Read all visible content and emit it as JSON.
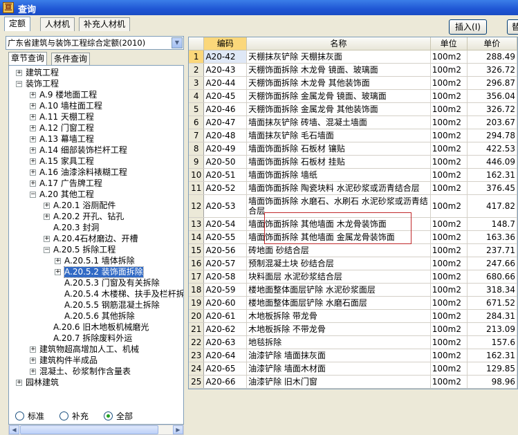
{
  "window": {
    "title": "查询",
    "app_icon": "app-icon"
  },
  "tabs": [
    {
      "label": "定额",
      "active": true
    },
    {
      "label": "人材机"
    },
    {
      "label": "补充人材机"
    }
  ],
  "toolbar": {
    "insert": "插入(I)",
    "more": "替"
  },
  "left": {
    "combo": "广东省建筑与装饰工程综合定额(2010)",
    "subtabs": [
      "章节查询",
      "条件查询"
    ],
    "tree": [
      {
        "lvl": 0,
        "exp": "+",
        "label": "建筑工程"
      },
      {
        "lvl": 0,
        "exp": "−",
        "label": "装饰工程"
      },
      {
        "lvl": 1,
        "exp": "+",
        "label": "A.9 楼地面工程"
      },
      {
        "lvl": 1,
        "exp": "+",
        "label": "A.10 墙柱面工程"
      },
      {
        "lvl": 1,
        "exp": "+",
        "label": "A.11 天棚工程"
      },
      {
        "lvl": 1,
        "exp": "+",
        "label": "A.12 门窗工程"
      },
      {
        "lvl": 1,
        "exp": "+",
        "label": "A.13 幕墙工程"
      },
      {
        "lvl": 1,
        "exp": "+",
        "label": "A.14 细部装饰栏杆工程"
      },
      {
        "lvl": 1,
        "exp": "+",
        "label": "A.15 家具工程"
      },
      {
        "lvl": 1,
        "exp": "+",
        "label": "A.16 油漆涂料裱糊工程"
      },
      {
        "lvl": 1,
        "exp": "+",
        "label": "A.17 广告牌工程"
      },
      {
        "lvl": 1,
        "exp": "−",
        "label": "A.20 其他工程"
      },
      {
        "lvl": 2,
        "exp": "+",
        "label": "A.20.1 浴厕配件"
      },
      {
        "lvl": 2,
        "exp": "+",
        "label": "A.20.2 开孔、钻孔"
      },
      {
        "lvl": 2,
        "exp": "",
        "label": "A.20.3 封洞"
      },
      {
        "lvl": 2,
        "exp": "+",
        "label": "A.20.4石材磨边、开槽"
      },
      {
        "lvl": 2,
        "exp": "−",
        "label": "A.20.5 拆除工程"
      },
      {
        "lvl": 3,
        "exp": "+",
        "label": "A.20.5.1 墙体拆除"
      },
      {
        "lvl": 3,
        "exp": "+",
        "label": "A.20.5.2 装饰面拆除",
        "sel": true
      },
      {
        "lvl": 3,
        "exp": "",
        "label": "A.20.5.3 门窗及有关拆除"
      },
      {
        "lvl": 3,
        "exp": "",
        "label": "A.20.5.4 木楼梯、扶手及栏杆拆"
      },
      {
        "lvl": 3,
        "exp": "",
        "label": "A.20.5.5 钢筋混凝土拆除"
      },
      {
        "lvl": 3,
        "exp": "",
        "label": "A.20.5.6 其他拆除"
      },
      {
        "lvl": 2,
        "exp": "",
        "label": "A.20.6 旧木地板机械磨光"
      },
      {
        "lvl": 2,
        "exp": "",
        "label": "A.20.7 拆除废料外运"
      },
      {
        "lvl": 1,
        "exp": "+",
        "label": "建筑物超高增加人工、机械"
      },
      {
        "lvl": 1,
        "exp": "+",
        "label": "建筑构件半成品"
      },
      {
        "lvl": 1,
        "exp": "+",
        "label": "混凝土、砂浆制作含量表"
      },
      {
        "lvl": 0,
        "exp": "+",
        "label": "园林建筑"
      }
    ],
    "radios": [
      {
        "label": "标准",
        "on": false
      },
      {
        "label": "补充",
        "on": false
      },
      {
        "label": "全部",
        "on": true
      }
    ]
  },
  "grid": {
    "headers": [
      "",
      "编码",
      "名称",
      "单位",
      "单价"
    ],
    "rows": [
      [
        "1",
        "A20-42",
        "天棚抹灰铲除 天棚抹灰面",
        "100m2",
        "288.49"
      ],
      [
        "2",
        "A20-43",
        "天棚饰面拆除 木龙骨 镜面、玻璃面",
        "100m2",
        "326.72"
      ],
      [
        "3",
        "A20-44",
        "天棚饰面拆除 木龙骨 其他装饰面",
        "100m2",
        "296.87"
      ],
      [
        "4",
        "A20-45",
        "天棚饰面拆除 金属龙骨 镜面、玻璃面",
        "100m2",
        "356.04"
      ],
      [
        "5",
        "A20-46",
        "天棚饰面拆除 金属龙骨 其他装饰面",
        "100m2",
        "326.72"
      ],
      [
        "6",
        "A20-47",
        "墙面抹灰铲除 砖墙、混凝土墙面",
        "100m2",
        "203.67"
      ],
      [
        "7",
        "A20-48",
        "墙面抹灰铲除 毛石墙面",
        "100m2",
        "294.78"
      ],
      [
        "8",
        "A20-49",
        "墙面饰面拆除 石板材 镶贴",
        "100m2",
        "422.53"
      ],
      [
        "9",
        "A20-50",
        "墙面饰面拆除 石板材 挂贴",
        "100m2",
        "446.09"
      ],
      [
        "10",
        "A20-51",
        "墙面饰面拆除 墙纸",
        "100m2",
        "162.31"
      ],
      [
        "11",
        "A20-52",
        "墙面饰面拆除 陶瓷块料 水泥砂浆或沥青结合层",
        "100m2",
        "376.45"
      ],
      [
        "12",
        "A20-53",
        "墙面饰面拆除 水磨石、水刷石 水泥砂浆或沥青结合层",
        "100m2",
        "417.82"
      ],
      [
        "13",
        "A20-54",
        "墙面饰面拆除 其他墙面 木龙骨装饰面",
        "100m2",
        "148.7"
      ],
      [
        "14",
        "A20-55",
        "墙面饰面拆除 其他墙面 金属龙骨装饰面",
        "100m2",
        "163.36"
      ],
      [
        "15",
        "A20-56",
        "砖地面 砂结合层",
        "100m2",
        "237.71"
      ],
      [
        "16",
        "A20-57",
        "预制混凝土块 砂结合层",
        "100m2",
        "247.66"
      ],
      [
        "17",
        "A20-58",
        "块料面层 水泥砂浆结合层",
        "100m2",
        "680.66"
      ],
      [
        "18",
        "A20-59",
        "楼地面整体面层铲除 水泥砂浆面层",
        "100m2",
        "318.34"
      ],
      [
        "19",
        "A20-60",
        "楼地面整体面层铲除 水磨石面层",
        "100m2",
        "671.52"
      ],
      [
        "20",
        "A20-61",
        "木地板拆除 带龙骨",
        "100m2",
        "284.31"
      ],
      [
        "21",
        "A20-62",
        "木地板拆除 不带龙骨",
        "100m2",
        "213.09"
      ],
      [
        "22",
        "A20-63",
        "地毯拆除",
        "100m2",
        "157.6"
      ],
      [
        "23",
        "A20-64",
        "油漆铲除 墙面抹灰面",
        "100m2",
        "162.31"
      ],
      [
        "24",
        "A20-65",
        "油漆铲除 墙面木材面",
        "100m2",
        "129.85"
      ],
      [
        "25",
        "A20-66",
        "油漆铲除 旧木门窗",
        "100m2",
        "98.96"
      ]
    ]
  }
}
